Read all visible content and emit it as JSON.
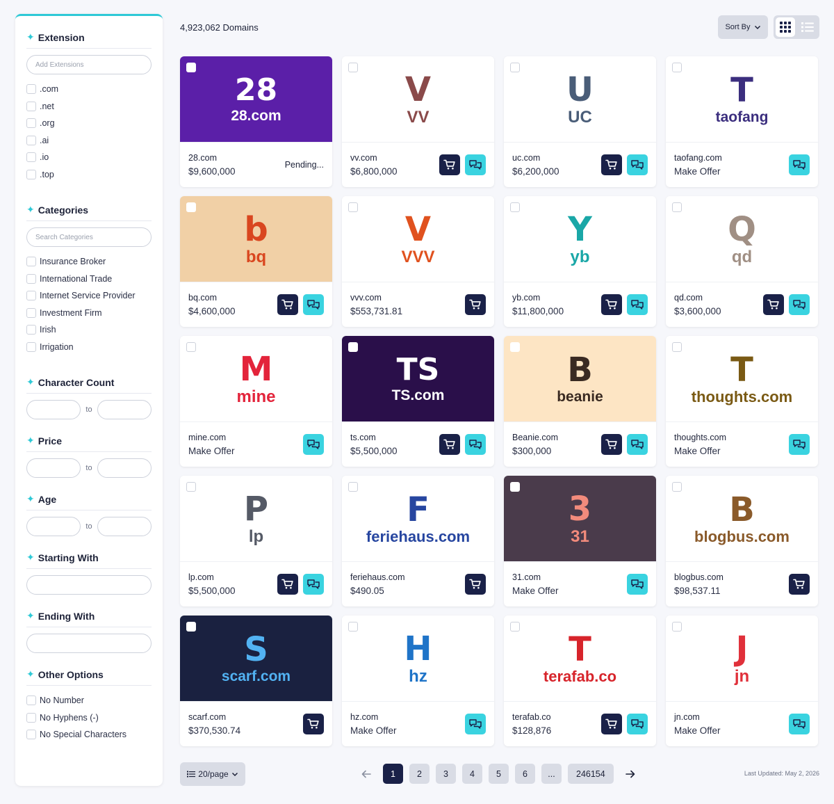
{
  "header": {
    "domain_count": "4,923,062 Domains",
    "sort_label": "Sort By"
  },
  "filters": {
    "extension": {
      "title": "Extension",
      "placeholder": "Add Extensions",
      "options": [
        ".com",
        ".net",
        ".org",
        ".ai",
        ".io",
        ".top"
      ]
    },
    "categories": {
      "title": "Categories",
      "placeholder": "Search Categories",
      "options": [
        "Insurance Broker",
        "International Trade",
        "Internet Service Provider",
        "Investment Firm",
        "Irish",
        "Irrigation"
      ]
    },
    "character_count": {
      "title": "Character Count",
      "to": "to"
    },
    "price": {
      "title": "Price",
      "to": "to"
    },
    "age": {
      "title": "Age",
      "to": "to"
    },
    "starting_with": {
      "title": "Starting With"
    },
    "ending_with": {
      "title": "Ending With"
    },
    "other_options": {
      "title": "Other Options",
      "options": [
        "No Number",
        "No Hyphens (-)",
        "No Special Characters"
      ]
    }
  },
  "cards": [
    {
      "name": "28.com",
      "price": "$9,600,000",
      "status": "Pending...",
      "cart": false,
      "chat": false,
      "logo": {
        "bg": "#5b1fa8",
        "text": "28.com",
        "mark": "28",
        "color": "#ffffff"
      }
    },
    {
      "name": "vv.com",
      "price": "$6,800,000",
      "cart": true,
      "chat": true,
      "logo": {
        "bg": "#ffffff",
        "text": "VV",
        "mark": "V",
        "color": "#8a4a4a"
      }
    },
    {
      "name": "uc.com",
      "price": "$6,200,000",
      "cart": true,
      "chat": true,
      "logo": {
        "bg": "#ffffff",
        "text": "UC",
        "mark": "U",
        "color": "#4a5d78"
      }
    },
    {
      "name": "taofang.com",
      "price": "Make Offer",
      "cart": false,
      "chat": true,
      "logo": {
        "bg": "#ffffff",
        "text": "taofang",
        "mark": "T",
        "color": "#3b2e7e"
      }
    },
    {
      "name": "bq.com",
      "price": "$4,600,000",
      "cart": true,
      "chat": true,
      "logo": {
        "bg": "#f1d0a6",
        "text": "bq",
        "mark": "b",
        "color": "#d9461f"
      }
    },
    {
      "name": "vvv.com",
      "price": "$553,731.81",
      "cart": true,
      "chat": false,
      "logo": {
        "bg": "#ffffff",
        "text": "VVV",
        "mark": "V",
        "color": "#e0521f"
      }
    },
    {
      "name": "yb.com",
      "price": "$11,800,000",
      "cart": true,
      "chat": true,
      "logo": {
        "bg": "#ffffff",
        "text": "yb",
        "mark": "Y",
        "color": "#1aa7a7"
      }
    },
    {
      "name": "qd.com",
      "price": "$3,600,000",
      "cart": true,
      "chat": true,
      "logo": {
        "bg": "#ffffff",
        "text": "qd",
        "mark": "Q",
        "color": "#a08f84"
      }
    },
    {
      "name": "mine.com",
      "price": "Make Offer",
      "cart": false,
      "chat": true,
      "logo": {
        "bg": "#ffffff",
        "text": "mine",
        "mark": "M",
        "color": "#e3243b"
      }
    },
    {
      "name": "ts.com",
      "price": "$5,500,000",
      "cart": true,
      "chat": true,
      "logo": {
        "bg": "#2a0f4a",
        "text": "TS.com",
        "mark": "TS",
        "color": "#ffffff"
      }
    },
    {
      "name": "Beanie.com",
      "price": "$300,000",
      "cart": true,
      "chat": true,
      "logo": {
        "bg": "#fde5c4",
        "text": "beanie",
        "mark": "B",
        "color": "#3a2a22"
      }
    },
    {
      "name": "thoughts.com",
      "price": "Make Offer",
      "cart": false,
      "chat": true,
      "logo": {
        "bg": "#ffffff",
        "text": "thoughts.com",
        "mark": "T",
        "color": "#7a5a14"
      }
    },
    {
      "name": "lp.com",
      "price": "$5,500,000",
      "cart": true,
      "chat": true,
      "logo": {
        "bg": "#ffffff",
        "text": "lp",
        "mark": "P",
        "color": "#555a66"
      }
    },
    {
      "name": "feriehaus.com",
      "price": "$490.05",
      "cart": true,
      "chat": false,
      "logo": {
        "bg": "#ffffff",
        "text": "feriehaus.com",
        "mark": "F",
        "color": "#2746a0"
      }
    },
    {
      "name": "31.com",
      "price": "Make Offer",
      "cart": false,
      "chat": true,
      "logo": {
        "bg": "#4a3b4b",
        "text": "31",
        "mark": "3",
        "color": "#f28b7c"
      }
    },
    {
      "name": "blogbus.com",
      "price": "$98,537.11",
      "cart": true,
      "chat": false,
      "logo": {
        "bg": "#ffffff",
        "text": "blogbus.com",
        "mark": "B",
        "color": "#8a5a2a"
      }
    },
    {
      "name": "scarf.com",
      "price": "$370,530.74",
      "cart": true,
      "chat": false,
      "logo": {
        "bg": "#1a2140",
        "text": "scarf.com",
        "mark": "S",
        "color": "#52b2f2"
      }
    },
    {
      "name": "hz.com",
      "price": "Make Offer",
      "cart": false,
      "chat": true,
      "logo": {
        "bg": "#ffffff",
        "text": "hz",
        "mark": "H",
        "color": "#1f74c8"
      }
    },
    {
      "name": "terafab.co",
      "price": "$128,876",
      "cart": true,
      "chat": true,
      "logo": {
        "bg": "#ffffff",
        "text": "terafab.co",
        "mark": "T",
        "color": "#d7242b"
      }
    },
    {
      "name": "jn.com",
      "price": "Make Offer",
      "cart": false,
      "chat": true,
      "logo": {
        "bg": "#ffffff",
        "text": "jn",
        "mark": "J",
        "color": "#e0303a"
      }
    }
  ],
  "pagination": {
    "per_page": "20/page",
    "pages": [
      "1",
      "2",
      "3",
      "4",
      "5",
      "6",
      "...",
      "246154"
    ],
    "active": "1",
    "last_updated": "Last Updated: May 2, 2026"
  },
  "colors": {
    "accent": "#2ec9d6",
    "cart_button": "#1a2148",
    "chat_button": "#3ad3e0"
  }
}
